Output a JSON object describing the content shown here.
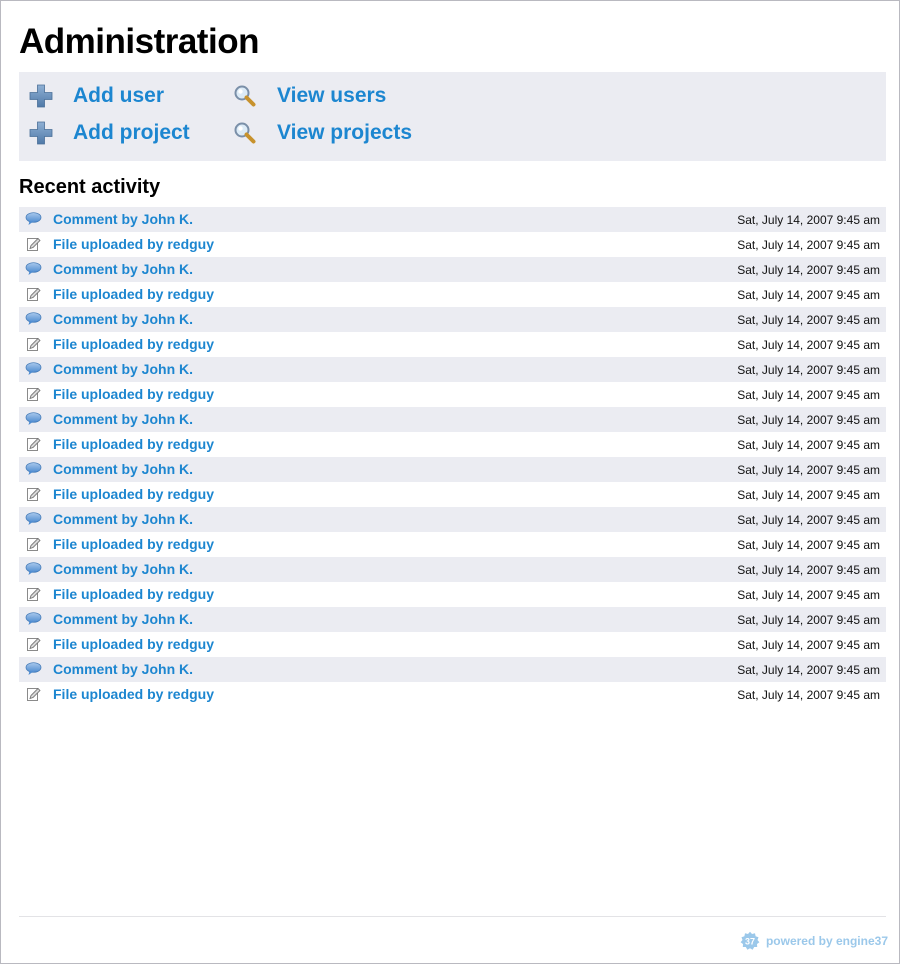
{
  "page": {
    "title": "Administration"
  },
  "quick_actions": {
    "add_user": {
      "label": "Add user",
      "icon": "plus-icon"
    },
    "add_project": {
      "label": "Add project",
      "icon": "plus-icon"
    },
    "view_users": {
      "label": "View users",
      "icon": "magnifier-icon"
    },
    "view_projects": {
      "label": "View projects",
      "icon": "magnifier-icon"
    }
  },
  "recent_activity": {
    "title": "Recent activity",
    "items": [
      {
        "type": "comment",
        "icon": "comment-bubble-icon",
        "text": "Comment by John K.",
        "date": "Sat, July 14, 2007 9:45 am"
      },
      {
        "type": "file",
        "icon": "file-edit-icon",
        "text": "File uploaded by redguy",
        "date": "Sat, July 14, 2007 9:45 am"
      },
      {
        "type": "comment",
        "icon": "comment-bubble-icon",
        "text": "Comment by John K.",
        "date": "Sat, July 14, 2007 9:45 am"
      },
      {
        "type": "file",
        "icon": "file-edit-icon",
        "text": "File uploaded by redguy",
        "date": "Sat, July 14, 2007 9:45 am"
      },
      {
        "type": "comment",
        "icon": "comment-bubble-icon",
        "text": "Comment by John K.",
        "date": "Sat, July 14, 2007 9:45 am"
      },
      {
        "type": "file",
        "icon": "file-edit-icon",
        "text": "File uploaded by redguy",
        "date": "Sat, July 14, 2007 9:45 am"
      },
      {
        "type": "comment",
        "icon": "comment-bubble-icon",
        "text": "Comment by John K.",
        "date": "Sat, July 14, 2007 9:45 am"
      },
      {
        "type": "file",
        "icon": "file-edit-icon",
        "text": "File uploaded by redguy",
        "date": "Sat, July 14, 2007 9:45 am"
      },
      {
        "type": "comment",
        "icon": "comment-bubble-icon",
        "text": "Comment by John K.",
        "date": "Sat, July 14, 2007 9:45 am"
      },
      {
        "type": "file",
        "icon": "file-edit-icon",
        "text": "File uploaded by redguy",
        "date": "Sat, July 14, 2007 9:45 am"
      },
      {
        "type": "comment",
        "icon": "comment-bubble-icon",
        "text": "Comment by John K.",
        "date": "Sat, July 14, 2007 9:45 am"
      },
      {
        "type": "file",
        "icon": "file-edit-icon",
        "text": "File uploaded by redguy",
        "date": "Sat, July 14, 2007 9:45 am"
      },
      {
        "type": "comment",
        "icon": "comment-bubble-icon",
        "text": "Comment by John K.",
        "date": "Sat, July 14, 2007 9:45 am"
      },
      {
        "type": "file",
        "icon": "file-edit-icon",
        "text": "File uploaded by redguy",
        "date": "Sat, July 14, 2007 9:45 am"
      },
      {
        "type": "comment",
        "icon": "comment-bubble-icon",
        "text": "Comment by John K.",
        "date": "Sat, July 14, 2007 9:45 am"
      },
      {
        "type": "file",
        "icon": "file-edit-icon",
        "text": "File uploaded by redguy",
        "date": "Sat, July 14, 2007 9:45 am"
      },
      {
        "type": "comment",
        "icon": "comment-bubble-icon",
        "text": "Comment by John K.",
        "date": "Sat, July 14, 2007 9:45 am"
      },
      {
        "type": "file",
        "icon": "file-edit-icon",
        "text": "File uploaded by redguy",
        "date": "Sat, July 14, 2007 9:45 am"
      },
      {
        "type": "comment",
        "icon": "comment-bubble-icon",
        "text": "Comment by John K.",
        "date": "Sat, July 14, 2007 9:45 am"
      },
      {
        "type": "file",
        "icon": "file-edit-icon",
        "text": "File uploaded by redguy",
        "date": "Sat, July 14, 2007 9:45 am"
      }
    ]
  },
  "footer": {
    "powered_by": "powered by engine37",
    "logo_icon": "engine37-gear-icon",
    "logo_text": "37"
  },
  "colors": {
    "link": "#1c86d0",
    "panel_bg": "#ebecf2",
    "powered": "#9bc8ea"
  }
}
